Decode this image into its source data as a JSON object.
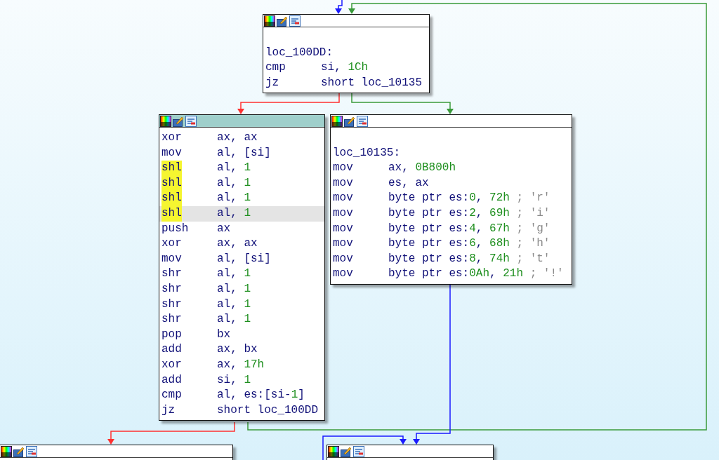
{
  "blocks": [
    {
      "selected": false,
      "lines": [
        {
          "kind": "label",
          "text": "loc_100DD:"
        },
        {
          "kind": "instr",
          "mnemonic": "cmp",
          "highlighted": false,
          "selected": false,
          "operands": [
            {
              "kind": "reg",
              "t": "si, "
            },
            {
              "kind": "num",
              "t": "1Ch"
            }
          ]
        },
        {
          "kind": "instr",
          "mnemonic": "jz",
          "highlighted": false,
          "selected": false,
          "operands": [
            {
              "kind": "reg",
              "t": "short loc_10135"
            }
          ]
        }
      ]
    },
    {
      "selected": true,
      "lines": [
        {
          "kind": "instr",
          "mnemonic": "xor",
          "highlighted": false,
          "selected": false,
          "operands": [
            {
              "kind": "reg",
              "t": "ax, ax"
            }
          ]
        },
        {
          "kind": "instr",
          "mnemonic": "mov",
          "highlighted": false,
          "selected": false,
          "operands": [
            {
              "kind": "reg",
              "t": "al, [si]"
            }
          ]
        },
        {
          "kind": "instr",
          "mnemonic": "shl",
          "highlighted": true,
          "selected": false,
          "operands": [
            {
              "kind": "reg",
              "t": "al, "
            },
            {
              "kind": "num",
              "t": "1"
            }
          ]
        },
        {
          "kind": "instr",
          "mnemonic": "shl",
          "highlighted": true,
          "selected": false,
          "operands": [
            {
              "kind": "reg",
              "t": "al, "
            },
            {
              "kind": "num",
              "t": "1"
            }
          ]
        },
        {
          "kind": "instr",
          "mnemonic": "shl",
          "highlighted": true,
          "selected": false,
          "operands": [
            {
              "kind": "reg",
              "t": "al, "
            },
            {
              "kind": "num",
              "t": "1"
            }
          ]
        },
        {
          "kind": "instr",
          "mnemonic": "shl",
          "highlighted": true,
          "selected": true,
          "operands": [
            {
              "kind": "reg",
              "t": "al, "
            },
            {
              "kind": "num",
              "t": "1"
            }
          ]
        },
        {
          "kind": "instr",
          "mnemonic": "push",
          "highlighted": false,
          "selected": false,
          "operands": [
            {
              "kind": "reg",
              "t": "ax"
            }
          ]
        },
        {
          "kind": "instr",
          "mnemonic": "xor",
          "highlighted": false,
          "selected": false,
          "operands": [
            {
              "kind": "reg",
              "t": "ax, ax"
            }
          ]
        },
        {
          "kind": "instr",
          "mnemonic": "mov",
          "highlighted": false,
          "selected": false,
          "operands": [
            {
              "kind": "reg",
              "t": "al, [si]"
            }
          ]
        },
        {
          "kind": "instr",
          "mnemonic": "shr",
          "highlighted": false,
          "selected": false,
          "operands": [
            {
              "kind": "reg",
              "t": "al, "
            },
            {
              "kind": "num",
              "t": "1"
            }
          ]
        },
        {
          "kind": "instr",
          "mnemonic": "shr",
          "highlighted": false,
          "selected": false,
          "operands": [
            {
              "kind": "reg",
              "t": "al, "
            },
            {
              "kind": "num",
              "t": "1"
            }
          ]
        },
        {
          "kind": "instr",
          "mnemonic": "shr",
          "highlighted": false,
          "selected": false,
          "operands": [
            {
              "kind": "reg",
              "t": "al, "
            },
            {
              "kind": "num",
              "t": "1"
            }
          ]
        },
        {
          "kind": "instr",
          "mnemonic": "shr",
          "highlighted": false,
          "selected": false,
          "operands": [
            {
              "kind": "reg",
              "t": "al, "
            },
            {
              "kind": "num",
              "t": "1"
            }
          ]
        },
        {
          "kind": "instr",
          "mnemonic": "pop",
          "highlighted": false,
          "selected": false,
          "operands": [
            {
              "kind": "reg",
              "t": "bx"
            }
          ]
        },
        {
          "kind": "instr",
          "mnemonic": "add",
          "highlighted": false,
          "selected": false,
          "operands": [
            {
              "kind": "reg",
              "t": "ax, bx"
            }
          ]
        },
        {
          "kind": "instr",
          "mnemonic": "xor",
          "highlighted": false,
          "selected": false,
          "operands": [
            {
              "kind": "reg",
              "t": "ax, "
            },
            {
              "kind": "num",
              "t": "17h"
            }
          ]
        },
        {
          "kind": "instr",
          "mnemonic": "add",
          "highlighted": false,
          "selected": false,
          "operands": [
            {
              "kind": "reg",
              "t": "si, "
            },
            {
              "kind": "num",
              "t": "1"
            }
          ]
        },
        {
          "kind": "instr",
          "mnemonic": "cmp",
          "highlighted": false,
          "selected": false,
          "operands": [
            {
              "kind": "reg",
              "t": "al, es:[si-"
            },
            {
              "kind": "num",
              "t": "1"
            },
            {
              "kind": "reg",
              "t": "]"
            }
          ]
        },
        {
          "kind": "instr",
          "mnemonic": "jz",
          "highlighted": false,
          "selected": false,
          "operands": [
            {
              "kind": "reg",
              "t": "short loc_100DD"
            }
          ]
        }
      ]
    },
    {
      "selected": false,
      "lines": [
        {
          "kind": "label",
          "text": "loc_10135:"
        },
        {
          "kind": "instr",
          "mnemonic": "mov",
          "highlighted": false,
          "selected": false,
          "operands": [
            {
              "kind": "reg",
              "t": "ax, "
            },
            {
              "kind": "num",
              "t": "0B800h"
            }
          ]
        },
        {
          "kind": "instr",
          "mnemonic": "mov",
          "highlighted": false,
          "selected": false,
          "operands": [
            {
              "kind": "reg",
              "t": "es, ax"
            }
          ]
        },
        {
          "kind": "instr",
          "mnemonic": "mov",
          "highlighted": false,
          "selected": false,
          "operands": [
            {
              "kind": "reg",
              "t": "byte ptr es:"
            },
            {
              "kind": "num",
              "t": "0"
            },
            {
              "kind": "reg",
              "t": ", "
            },
            {
              "kind": "num",
              "t": "72h"
            },
            {
              "kind": "comment",
              "t": " ; 'r'"
            }
          ]
        },
        {
          "kind": "instr",
          "mnemonic": "mov",
          "highlighted": false,
          "selected": false,
          "operands": [
            {
              "kind": "reg",
              "t": "byte ptr es:"
            },
            {
              "kind": "num",
              "t": "2"
            },
            {
              "kind": "reg",
              "t": ", "
            },
            {
              "kind": "num",
              "t": "69h"
            },
            {
              "kind": "comment",
              "t": " ; 'i'"
            }
          ]
        },
        {
          "kind": "instr",
          "mnemonic": "mov",
          "highlighted": false,
          "selected": false,
          "operands": [
            {
              "kind": "reg",
              "t": "byte ptr es:"
            },
            {
              "kind": "num",
              "t": "4"
            },
            {
              "kind": "reg",
              "t": ", "
            },
            {
              "kind": "num",
              "t": "67h"
            },
            {
              "kind": "comment",
              "t": " ; 'g'"
            }
          ]
        },
        {
          "kind": "instr",
          "mnemonic": "mov",
          "highlighted": false,
          "selected": false,
          "operands": [
            {
              "kind": "reg",
              "t": "byte ptr es:"
            },
            {
              "kind": "num",
              "t": "6"
            },
            {
              "kind": "reg",
              "t": ", "
            },
            {
              "kind": "num",
              "t": "68h"
            },
            {
              "kind": "comment",
              "t": " ; 'h'"
            }
          ]
        },
        {
          "kind": "instr",
          "mnemonic": "mov",
          "highlighted": false,
          "selected": false,
          "operands": [
            {
              "kind": "reg",
              "t": "byte ptr es:"
            },
            {
              "kind": "num",
              "t": "8"
            },
            {
              "kind": "reg",
              "t": ", "
            },
            {
              "kind": "num",
              "t": "74h"
            },
            {
              "kind": "comment",
              "t": " ; 't'"
            }
          ]
        },
        {
          "kind": "instr",
          "mnemonic": "mov",
          "highlighted": false,
          "selected": false,
          "operands": [
            {
              "kind": "reg",
              "t": "byte ptr es:"
            },
            {
              "kind": "num",
              "t": "0Ah"
            },
            {
              "kind": "reg",
              "t": ", "
            },
            {
              "kind": "num",
              "t": "21h"
            },
            {
              "kind": "comment",
              "t": " ; '!'"
            }
          ]
        }
      ]
    },
    {
      "selected": false
    },
    {
      "selected": false
    }
  ],
  "edges": [
    {
      "kind": "jump"
    },
    {
      "kind": "true"
    },
    {
      "kind": "false"
    },
    {
      "kind": "true"
    },
    {
      "kind": "false"
    },
    {
      "kind": "jump"
    },
    {
      "kind": "jump"
    }
  ]
}
